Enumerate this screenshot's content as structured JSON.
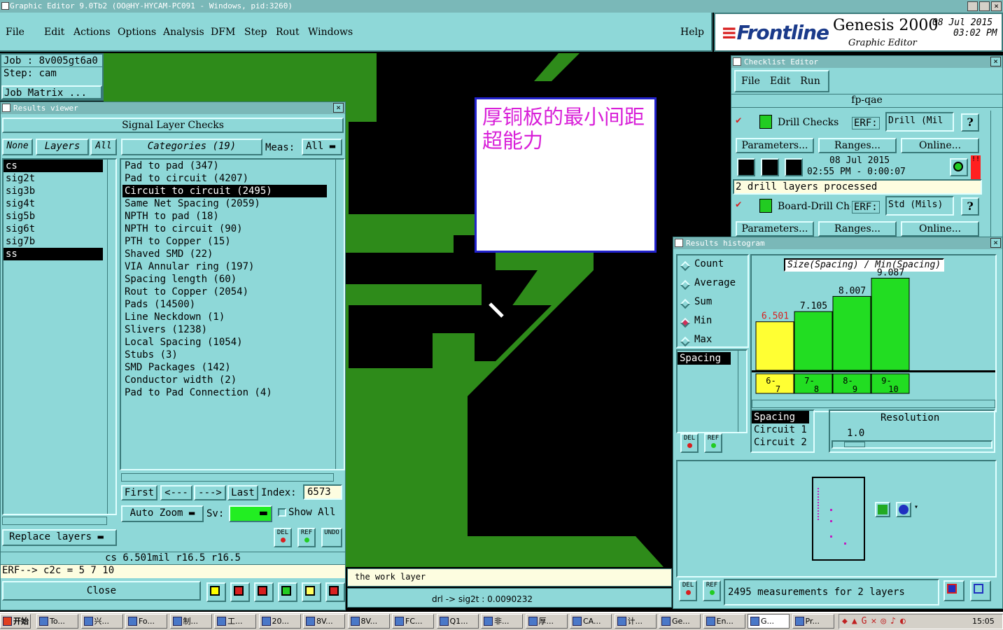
{
  "window_title": "Graphic Editor 9.0Tb2 (OO@HY-HYCAM-PC091 - Windows, pid:3260)",
  "menu": [
    "File",
    "Edit",
    "Actions",
    "Options",
    "Analysis",
    "DFM",
    "Step",
    "Rout",
    "Windows"
  ],
  "menu_help": "Help",
  "brand": {
    "logo": "Frontline",
    "product": "Genesis 2000",
    "subtitle": "Graphic Editor",
    "date": "08 Jul 2015",
    "time": "03:02 PM"
  },
  "job": {
    "job": "Job : 8v005gt6a0",
    "step": "Step: cam",
    "matrix": "Job Matrix ..."
  },
  "annotation": "厚铜板的最小间距超能力",
  "status": {
    "work_layer": "the work layer",
    "coord": "drl -> sig2t : 0.0090232"
  },
  "results_viewer": {
    "title": "Results viewer",
    "header": "Signal Layer Checks",
    "none": "None",
    "layers_label": "Layers",
    "all": "All",
    "layers": [
      "cs",
      "sig2t",
      "sig3b",
      "sig4t",
      "sig5b",
      "sig6t",
      "sig7b",
      "ss"
    ],
    "categories_label": "Categories (19)",
    "meas_label": "Meas:",
    "meas_value": "All",
    "categories": [
      "Pad to pad (347)",
      "Pad to circuit (4207)",
      "Circuit to circuit (2495)",
      "Same Net Spacing (2059)",
      "NPTH to pad (18)",
      "NPTH to circuit (90)",
      "PTH to Copper (15)",
      "Shaved SMD (22)",
      "VIA Annular ring (197)",
      "Spacing length (60)",
      "Rout to Copper (2054)",
      "Pads (14500)",
      "Line Neckdown (1)",
      "Slivers (1238)",
      "Local Spacing (1054)",
      "Stubs (3)",
      "SMD Packages (142)",
      "Conductor width (2)",
      "Pad to Pad Connection (4)"
    ],
    "nav": {
      "first": "First",
      "prev": "<---",
      "next": "--->",
      "last": "Last",
      "index_label": "Index:",
      "index_value": "6573"
    },
    "auto_zoom": "Auto Zoom",
    "sv_label": "Sv:",
    "show_all": "Show All",
    "replace_layers": "Replace layers",
    "del": "DEL",
    "ref": "REF",
    "undo": "UNDO",
    "info_line": "cs 6.501mil  r16.5  r16.5",
    "erf_line": "ERF--> c2c = 5 7 10",
    "close": "Close"
  },
  "checklist": {
    "title": "Checklist Editor",
    "menu": [
      "File",
      "Edit",
      "Run"
    ],
    "name": "fp-qae",
    "drill_checks": "Drill Checks",
    "erf_label": "ERF:",
    "drill_erf": "Drill (Mil",
    "parameters": "Parameters...",
    "ranges": "Ranges...",
    "online": "Online...",
    "run_date": "08 Jul 2015",
    "run_time": "02:55 PM - 0:00:07",
    "processed": "2 drill layers processed",
    "board_drill": "Board-Drill Che",
    "board_erf": "Std (Mils)",
    "q": "?"
  },
  "histogram": {
    "title": "Results histogram",
    "options": [
      "Count",
      "Average",
      "Sum",
      "Min",
      "Max"
    ],
    "selected_option": "Min",
    "chart_title": "Size(Spacing) / Min(Spacing)",
    "bars": [
      {
        "label": "6.501",
        "range": "6-7",
        "value": 6.501,
        "color": "#ffff33"
      },
      {
        "label": "7.105",
        "range": "7-8",
        "value": 7.105,
        "color": "#22dd22"
      },
      {
        "label": "8.007",
        "range": "8-9",
        "value": 8.007,
        "color": "#22dd22"
      },
      {
        "label": "9.087",
        "range": "9-10",
        "value": 9.087,
        "color": "#22dd22"
      }
    ],
    "list_item": "Spacing",
    "attrs": [
      "Spacing",
      "Circuit 1",
      "Circuit 2"
    ],
    "resolution_label": "Resolution",
    "resolution_value": "1.0",
    "measurements": "2495 measurements for 2 layers",
    "del": "DEL",
    "ref": "REF"
  },
  "taskbar": {
    "start": "开始",
    "items": [
      "To...",
      "兴...",
      "Fo...",
      "制...",
      "工...",
      "20...",
      "8V...",
      "8V...",
      "FC...",
      "Q1...",
      "非...",
      "厚...",
      "CA...",
      "计...",
      "Ge...",
      "En...",
      "G...",
      "Pr..."
    ],
    "clock": "15:05"
  }
}
